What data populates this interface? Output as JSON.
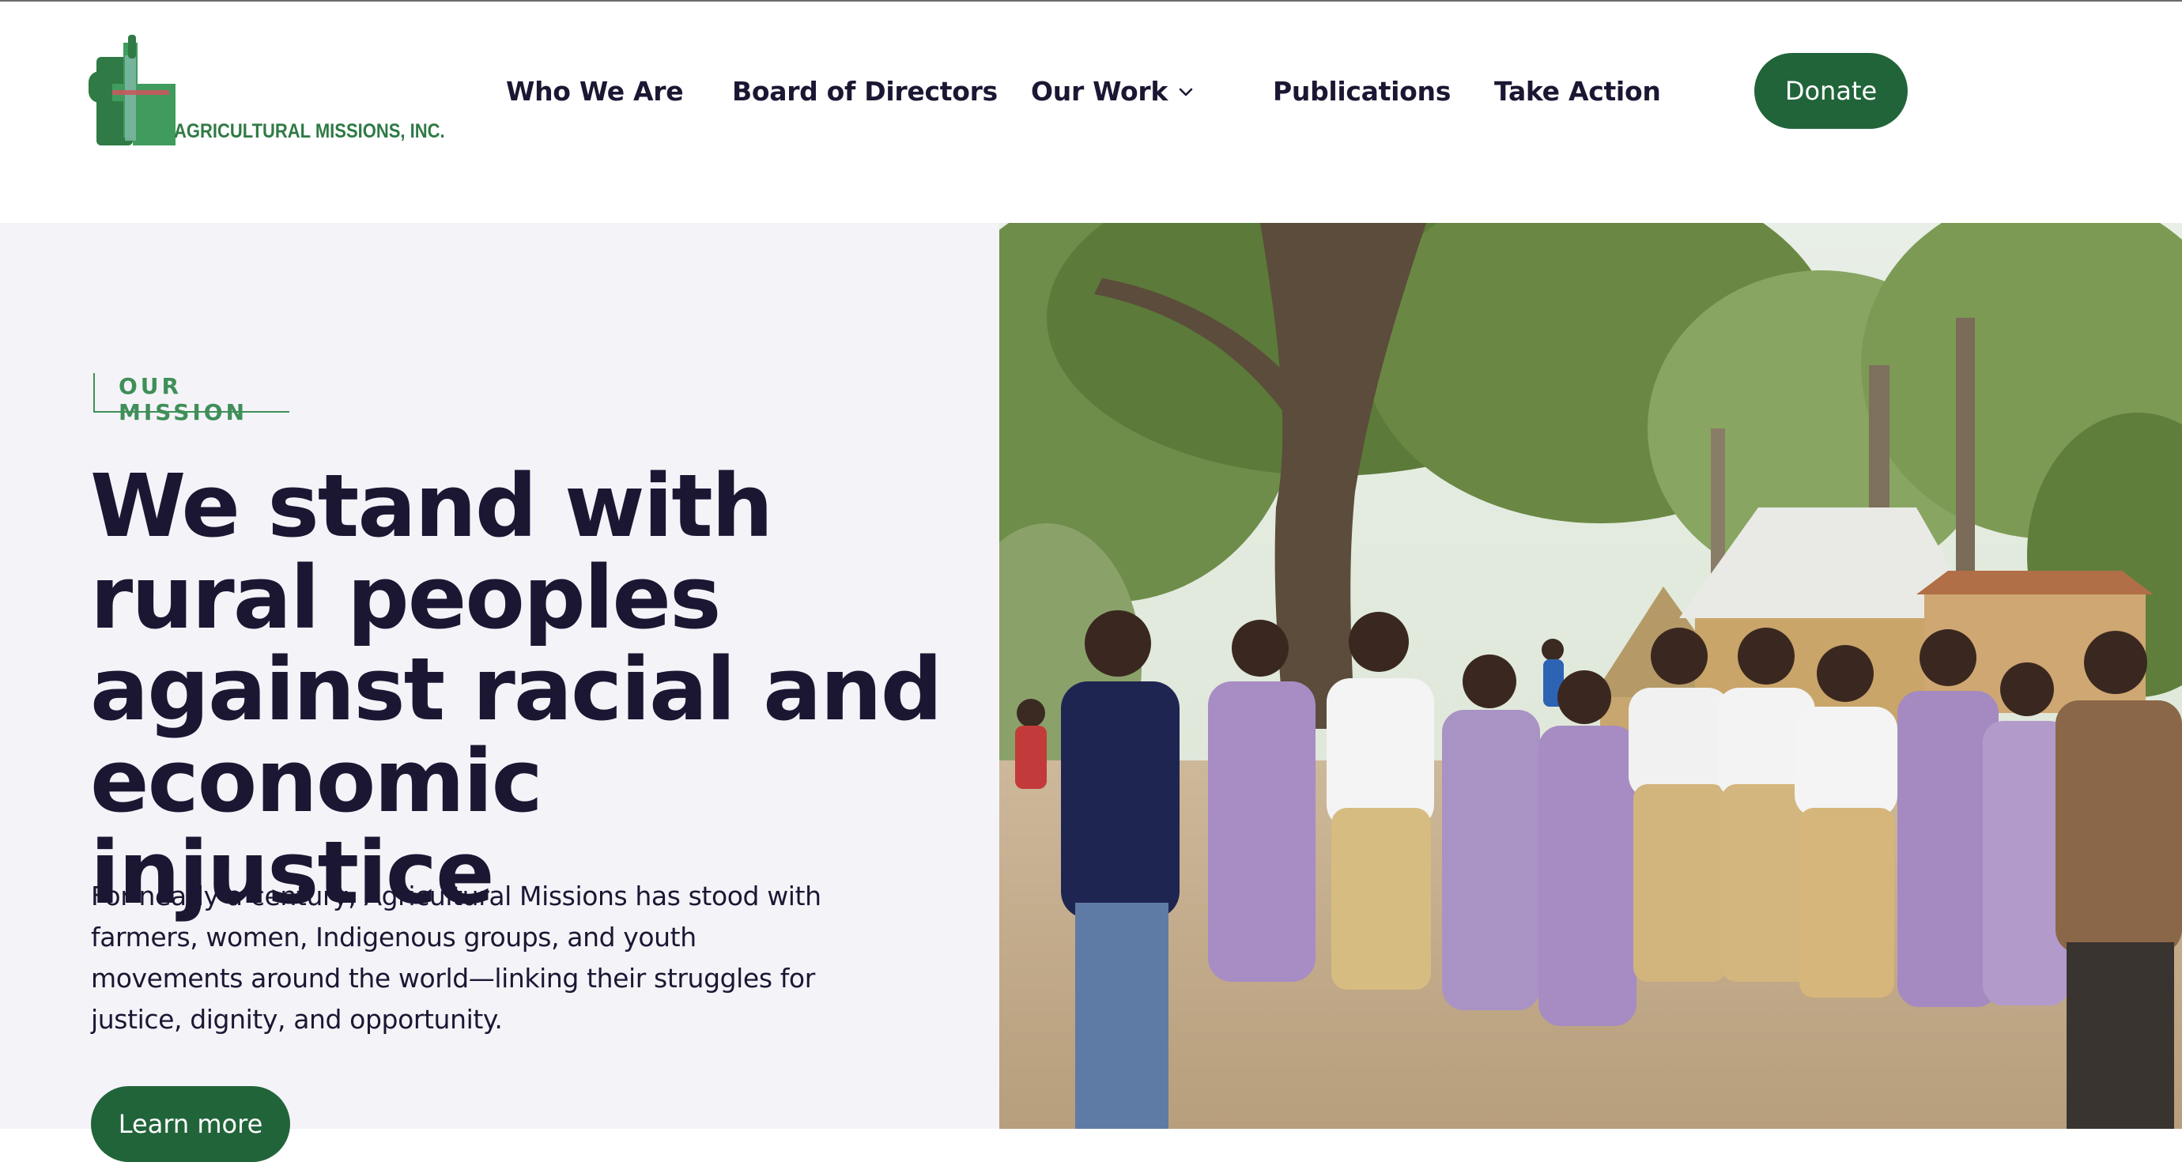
{
  "header": {
    "logo_text": "AGRICULTURAL MISSIONS, INC.",
    "nav": [
      {
        "label": "Who We Are"
      },
      {
        "label": "Board of Directors"
      },
      {
        "label": "Our Work",
        "icon": "chevron-down-icon"
      },
      {
        "label": "Publications"
      },
      {
        "label": "Take Action"
      }
    ],
    "donate_label": "Donate"
  },
  "hero": {
    "eyebrow": "OUR MISSION",
    "headline_lines": [
      "We stand with",
      "rural peoples",
      "against racial and",
      "economic injustice"
    ],
    "body": "For nearly a century, Agricultural Missions has stood with farmers, women, Indigenous groups, and youth movements around the world—linking their struggles for justice, dignity, and opportunity.",
    "cta_label": "Learn more"
  },
  "colors": {
    "brand_green": "#22643a",
    "accent_green": "#3f8f58",
    "text_dark": "#1b1733",
    "hero_bg": "#f4f3f8"
  }
}
